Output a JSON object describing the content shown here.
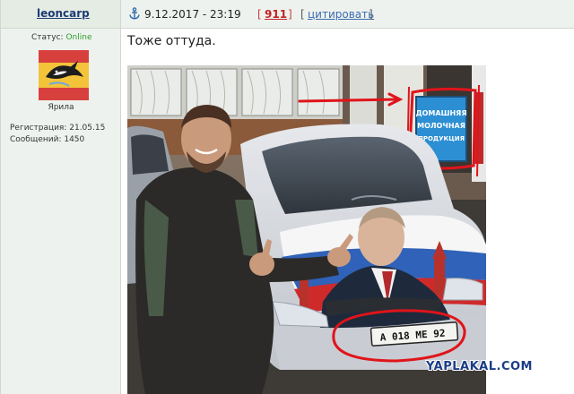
{
  "user": {
    "nickname": "leoncarp",
    "status_label": "Статус:",
    "status_value": "Online",
    "title": "Ярила",
    "registration": "Регистрация: 21.05.15",
    "messages": "Сообщений: 1450"
  },
  "post": {
    "date": "9.12.2017 - 23:19",
    "bracket_open": "[",
    "bracket_close": "]",
    "rating": "911",
    "quote_bracket_open": "[",
    "quote_label": "цитировать",
    "quote_bracket_close": "]",
    "text": "Тоже оттуда."
  },
  "photo": {
    "shop_sign_line1": "ДОМАШНЯЯ",
    "shop_sign_line2": "МОЛОЧНАЯ",
    "shop_sign_line3": "ПРОДУКЦИЯ",
    "license_plate": "А 018 МЕ 92",
    "watermark": "YAPLAKAL.COM"
  },
  "colors": {
    "accent_link": "#1d3b75",
    "online": "#2e9d2e",
    "rating": "#c12424",
    "annotation_red": "#e0141a"
  }
}
